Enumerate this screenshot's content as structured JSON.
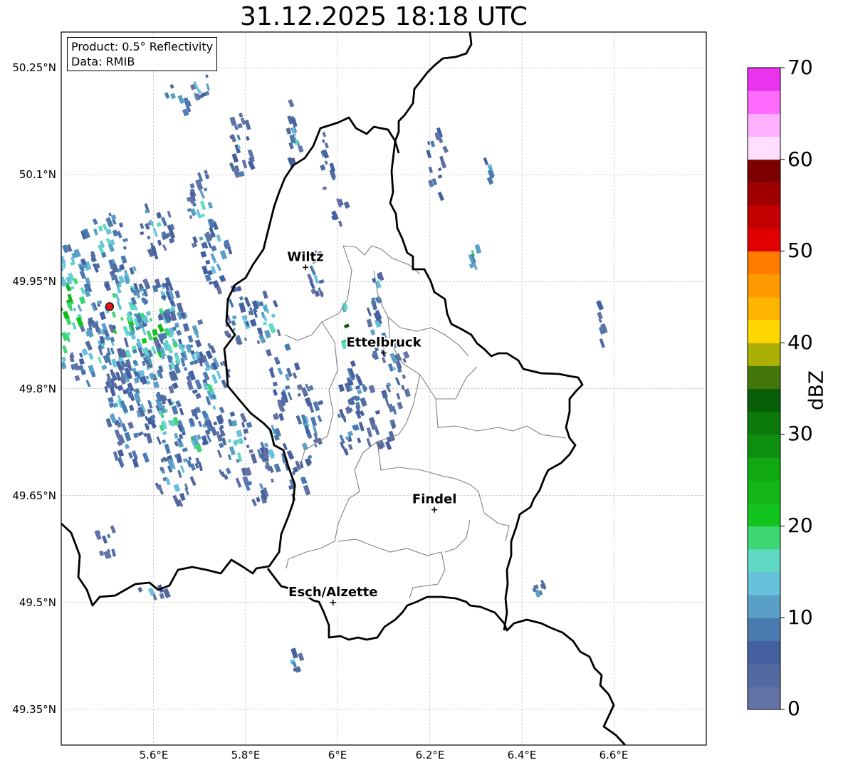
{
  "title": "31.12.2025 18:18 UTC",
  "info_box": {
    "product": "Product: 0.5° Reflectivity",
    "data": "Data: RMIB"
  },
  "axes": {
    "lon_range": [
      5.4,
      6.8
    ],
    "lat_range": [
      49.3,
      50.3
    ],
    "lon_ticks": [
      "5.6°E",
      "5.8°E",
      "6°E",
      "6.2°E",
      "6.4°E",
      "6.6°E"
    ],
    "lat_ticks": [
      "50.25°N",
      "50.1°N",
      "49.95°N",
      "49.8°N",
      "49.65°N",
      "49.5°N",
      "49.35°N"
    ],
    "grid": true
  },
  "cities": [
    {
      "name": "Wiltz",
      "lon": 5.93,
      "lat": 49.97
    },
    {
      "name": "Ettelbruck",
      "lon": 6.1,
      "lat": 49.85
    },
    {
      "name": "Findel",
      "lon": 6.21,
      "lat": 49.63
    },
    {
      "name": "Esch/Alzette",
      "lon": 5.99,
      "lat": 49.5
    }
  ],
  "radar_site": {
    "lon": 5.505,
    "lat": 49.915,
    "color": "#e3131b"
  },
  "colorbar": {
    "label": "dBZ",
    "ticks": [
      "0",
      "10",
      "20",
      "30",
      "40",
      "50",
      "60",
      "70"
    ],
    "range": [
      0,
      70
    ],
    "colors": [
      "#6271a6",
      "#536aa0",
      "#4560a0",
      "#4a7aaf",
      "#5a9fc6",
      "#67c1dc",
      "#5fd8c4",
      "#3dd675",
      "#14c41e",
      "#13b716",
      "#11a912",
      "#0e8e0f",
      "#0b7a0b",
      "#095e08",
      "#44770b",
      "#adb004",
      "#ffd600",
      "#ffb400",
      "#ff9b00",
      "#ff7c00",
      "#e10000",
      "#c40000",
      "#a00000",
      "#7c0000",
      "#ffdfff",
      "#ffb1ff",
      "#ff6aff",
      "#e933ec"
    ]
  },
  "radar_cells": [
    [
      5.4,
      49.92,
      0.07,
      0.09,
      26
    ],
    [
      5.53,
      49.9,
      0.06,
      0.08,
      24
    ],
    [
      5.6,
      49.88,
      0.07,
      0.08,
      23
    ],
    [
      5.47,
      49.85,
      0.06,
      0.05,
      16
    ],
    [
      5.57,
      49.8,
      0.05,
      0.06,
      14
    ],
    [
      5.65,
      49.86,
      0.06,
      0.06,
      18
    ],
    [
      5.72,
      49.8,
      0.04,
      0.07,
      14
    ],
    [
      5.63,
      49.76,
      0.05,
      0.04,
      20
    ],
    [
      5.52,
      49.78,
      0.04,
      0.04,
      12
    ],
    [
      5.68,
      49.73,
      0.04,
      0.04,
      18
    ],
    [
      5.55,
      49.72,
      0.04,
      0.03,
      12
    ],
    [
      5.77,
      49.72,
      0.04,
      0.05,
      16
    ],
    [
      5.64,
      49.68,
      0.04,
      0.04,
      14
    ],
    [
      5.49,
      50.01,
      0.05,
      0.04,
      18
    ],
    [
      5.6,
      50.03,
      0.04,
      0.04,
      14
    ],
    [
      5.7,
      50.05,
      0.03,
      0.06,
      14
    ],
    [
      5.73,
      49.99,
      0.03,
      0.05,
      16
    ],
    [
      5.78,
      49.9,
      0.03,
      0.05,
      14
    ],
    [
      5.84,
      49.9,
      0.03,
      0.05,
      16
    ],
    [
      5.88,
      49.82,
      0.03,
      0.05,
      12
    ],
    [
      5.93,
      49.76,
      0.03,
      0.06,
      12
    ],
    [
      5.86,
      49.72,
      0.03,
      0.05,
      12
    ],
    [
      5.91,
      49.67,
      0.02,
      0.03,
      10
    ],
    [
      5.82,
      49.68,
      0.03,
      0.04,
      12
    ],
    [
      6.04,
      49.8,
      0.04,
      0.04,
      10
    ],
    [
      6.12,
      49.82,
      0.03,
      0.05,
      12
    ],
    [
      6.08,
      49.89,
      0.02,
      0.05,
      12
    ],
    [
      6.02,
      49.75,
      0.03,
      0.04,
      10
    ],
    [
      6.09,
      49.74,
      0.03,
      0.03,
      10
    ],
    [
      5.95,
      49.96,
      0.02,
      0.04,
      10
    ],
    [
      5.9,
      50.16,
      0.02,
      0.05,
      12
    ],
    [
      5.78,
      50.14,
      0.03,
      0.05,
      10
    ],
    [
      5.97,
      50.12,
      0.02,
      0.04,
      10
    ],
    [
      6.21,
      50.12,
      0.02,
      0.05,
      10
    ],
    [
      6.08,
      49.95,
      0.01,
      0.05,
      14
    ],
    [
      6.01,
      49.89,
      0.01,
      0.03,
      40
    ],
    [
      5.66,
      50.21,
      0.04,
      0.02,
      14
    ],
    [
      5.7,
      50.23,
      0.02,
      0.02,
      20
    ],
    [
      5.49,
      49.59,
      0.03,
      0.02,
      10
    ],
    [
      5.6,
      49.52,
      0.04,
      0.01,
      12
    ],
    [
      5.9,
      49.42,
      0.02,
      0.02,
      12
    ],
    [
      6.43,
      49.53,
      0.01,
      0.02,
      18
    ],
    [
      6.32,
      50.11,
      0.01,
      0.02,
      22
    ],
    [
      6.56,
      49.89,
      0.01,
      0.04,
      8
    ],
    [
      6.29,
      49.99,
      0.01,
      0.02,
      26
    ],
    [
      6.0,
      50.05,
      0.02,
      0.02,
      12
    ]
  ]
}
